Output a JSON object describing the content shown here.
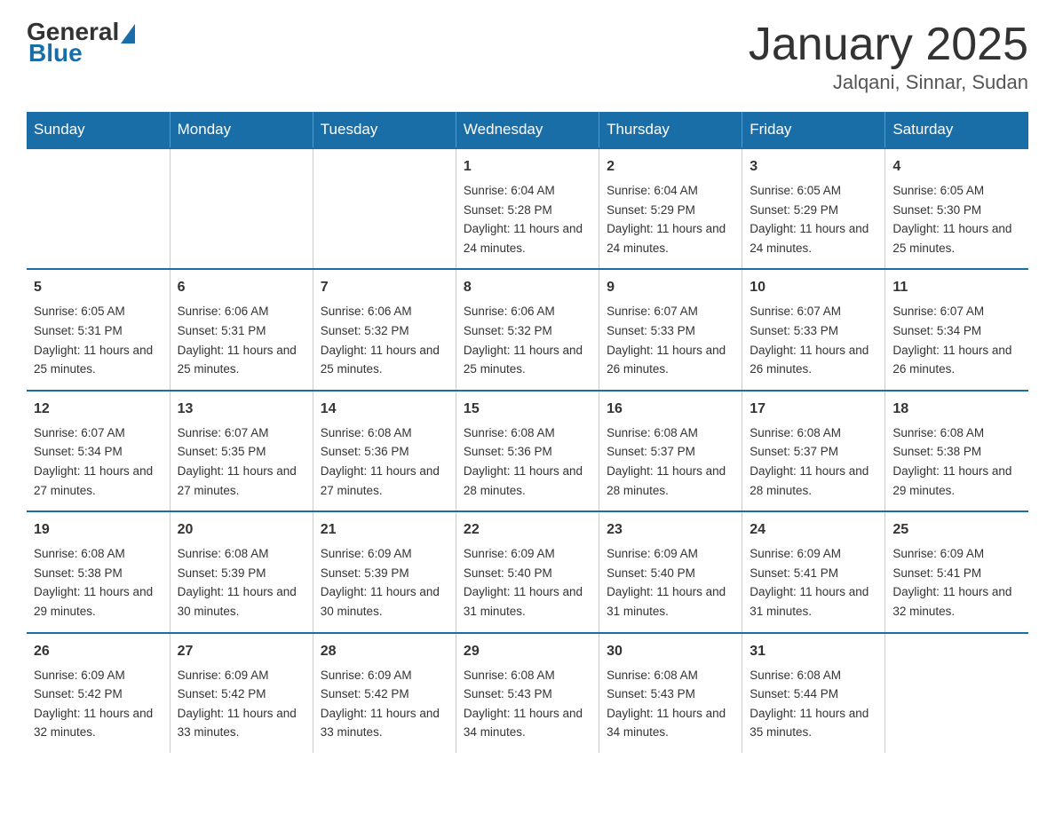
{
  "header": {
    "logo_general": "General",
    "logo_blue": "Blue",
    "month_title": "January 2025",
    "location": "Jalqani, Sinnar, Sudan"
  },
  "days_of_week": [
    "Sunday",
    "Monday",
    "Tuesday",
    "Wednesday",
    "Thursday",
    "Friday",
    "Saturday"
  ],
  "weeks": [
    {
      "days": [
        {
          "num": "",
          "info": ""
        },
        {
          "num": "",
          "info": ""
        },
        {
          "num": "",
          "info": ""
        },
        {
          "num": "1",
          "info": "Sunrise: 6:04 AM\nSunset: 5:28 PM\nDaylight: 11 hours and 24 minutes."
        },
        {
          "num": "2",
          "info": "Sunrise: 6:04 AM\nSunset: 5:29 PM\nDaylight: 11 hours and 24 minutes."
        },
        {
          "num": "3",
          "info": "Sunrise: 6:05 AM\nSunset: 5:29 PM\nDaylight: 11 hours and 24 minutes."
        },
        {
          "num": "4",
          "info": "Sunrise: 6:05 AM\nSunset: 5:30 PM\nDaylight: 11 hours and 25 minutes."
        }
      ]
    },
    {
      "days": [
        {
          "num": "5",
          "info": "Sunrise: 6:05 AM\nSunset: 5:31 PM\nDaylight: 11 hours and 25 minutes."
        },
        {
          "num": "6",
          "info": "Sunrise: 6:06 AM\nSunset: 5:31 PM\nDaylight: 11 hours and 25 minutes."
        },
        {
          "num": "7",
          "info": "Sunrise: 6:06 AM\nSunset: 5:32 PM\nDaylight: 11 hours and 25 minutes."
        },
        {
          "num": "8",
          "info": "Sunrise: 6:06 AM\nSunset: 5:32 PM\nDaylight: 11 hours and 25 minutes."
        },
        {
          "num": "9",
          "info": "Sunrise: 6:07 AM\nSunset: 5:33 PM\nDaylight: 11 hours and 26 minutes."
        },
        {
          "num": "10",
          "info": "Sunrise: 6:07 AM\nSunset: 5:33 PM\nDaylight: 11 hours and 26 minutes."
        },
        {
          "num": "11",
          "info": "Sunrise: 6:07 AM\nSunset: 5:34 PM\nDaylight: 11 hours and 26 minutes."
        }
      ]
    },
    {
      "days": [
        {
          "num": "12",
          "info": "Sunrise: 6:07 AM\nSunset: 5:34 PM\nDaylight: 11 hours and 27 minutes."
        },
        {
          "num": "13",
          "info": "Sunrise: 6:07 AM\nSunset: 5:35 PM\nDaylight: 11 hours and 27 minutes."
        },
        {
          "num": "14",
          "info": "Sunrise: 6:08 AM\nSunset: 5:36 PM\nDaylight: 11 hours and 27 minutes."
        },
        {
          "num": "15",
          "info": "Sunrise: 6:08 AM\nSunset: 5:36 PM\nDaylight: 11 hours and 28 minutes."
        },
        {
          "num": "16",
          "info": "Sunrise: 6:08 AM\nSunset: 5:37 PM\nDaylight: 11 hours and 28 minutes."
        },
        {
          "num": "17",
          "info": "Sunrise: 6:08 AM\nSunset: 5:37 PM\nDaylight: 11 hours and 28 minutes."
        },
        {
          "num": "18",
          "info": "Sunrise: 6:08 AM\nSunset: 5:38 PM\nDaylight: 11 hours and 29 minutes."
        }
      ]
    },
    {
      "days": [
        {
          "num": "19",
          "info": "Sunrise: 6:08 AM\nSunset: 5:38 PM\nDaylight: 11 hours and 29 minutes."
        },
        {
          "num": "20",
          "info": "Sunrise: 6:08 AM\nSunset: 5:39 PM\nDaylight: 11 hours and 30 minutes."
        },
        {
          "num": "21",
          "info": "Sunrise: 6:09 AM\nSunset: 5:39 PM\nDaylight: 11 hours and 30 minutes."
        },
        {
          "num": "22",
          "info": "Sunrise: 6:09 AM\nSunset: 5:40 PM\nDaylight: 11 hours and 31 minutes."
        },
        {
          "num": "23",
          "info": "Sunrise: 6:09 AM\nSunset: 5:40 PM\nDaylight: 11 hours and 31 minutes."
        },
        {
          "num": "24",
          "info": "Sunrise: 6:09 AM\nSunset: 5:41 PM\nDaylight: 11 hours and 31 minutes."
        },
        {
          "num": "25",
          "info": "Sunrise: 6:09 AM\nSunset: 5:41 PM\nDaylight: 11 hours and 32 minutes."
        }
      ]
    },
    {
      "days": [
        {
          "num": "26",
          "info": "Sunrise: 6:09 AM\nSunset: 5:42 PM\nDaylight: 11 hours and 32 minutes."
        },
        {
          "num": "27",
          "info": "Sunrise: 6:09 AM\nSunset: 5:42 PM\nDaylight: 11 hours and 33 minutes."
        },
        {
          "num": "28",
          "info": "Sunrise: 6:09 AM\nSunset: 5:42 PM\nDaylight: 11 hours and 33 minutes."
        },
        {
          "num": "29",
          "info": "Sunrise: 6:08 AM\nSunset: 5:43 PM\nDaylight: 11 hours and 34 minutes."
        },
        {
          "num": "30",
          "info": "Sunrise: 6:08 AM\nSunset: 5:43 PM\nDaylight: 11 hours and 34 minutes."
        },
        {
          "num": "31",
          "info": "Sunrise: 6:08 AM\nSunset: 5:44 PM\nDaylight: 11 hours and 35 minutes."
        },
        {
          "num": "",
          "info": ""
        }
      ]
    }
  ]
}
